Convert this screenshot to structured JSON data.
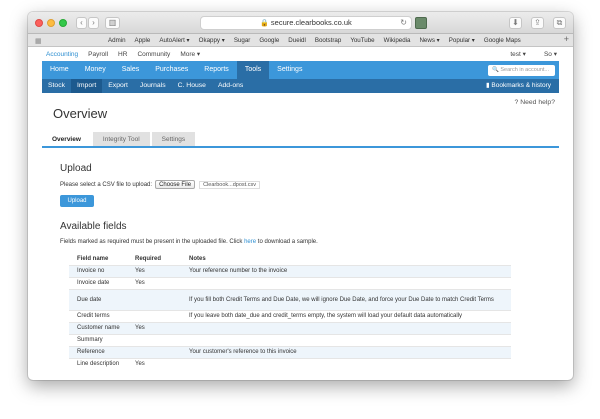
{
  "browser": {
    "url": "secure.clearbooks.co.uk",
    "bookmarks": [
      "Admin",
      "Apple",
      "AutoAlert ▾",
      "Okappy ▾",
      "Sugar",
      "Google",
      "Dueidl",
      "Bootstrap",
      "YouTube",
      "Wikipedia",
      "News ▾",
      "Popular ▾",
      "Google Maps"
    ]
  },
  "appnav": {
    "items": [
      "Accounting",
      "Payroll",
      "HR",
      "Community",
      "More ▾"
    ],
    "user": "test ▾",
    "user2": "So ▾"
  },
  "mainnav": {
    "items": [
      "Home",
      "Money",
      "Sales",
      "Purchases",
      "Reports",
      "Tools",
      "Settings"
    ],
    "search_placeholder": "Search in account..."
  },
  "subnav": {
    "items": [
      "Stock",
      "Import",
      "Export",
      "Journals",
      "C. House",
      "Add-ons"
    ],
    "bookmarks_history": "Bookmarks & history"
  },
  "page": {
    "title": "Overview",
    "help": "Need help?",
    "tabs": [
      "Overview",
      "Integrity Tool",
      "Settings"
    ]
  },
  "upload": {
    "heading": "Upload",
    "label": "Please select a CSV file to upload:",
    "choose_file": "Choose File",
    "file_name": "Clearbook...dpost.csv",
    "button": "Upload"
  },
  "fields": {
    "heading": "Available fields",
    "intro_prefix": "Fields marked as required must be present in the uploaded file. Click ",
    "intro_link": "here",
    "intro_suffix": " to download a sample.",
    "columns": [
      "Field name",
      "Required",
      "Notes"
    ],
    "rows": [
      {
        "name": "Invoice no",
        "required": "Yes",
        "notes": "Your reference number to the invoice"
      },
      {
        "name": "Invoice date",
        "required": "Yes",
        "notes": ""
      },
      {
        "name": "Due date",
        "required": "",
        "notes": "If you fill both Credit Terms and Due Date, we will ignore Due Date, and force your Due Date to match Credit Terms"
      },
      {
        "name": "Credit terms",
        "required": "",
        "notes": "If you leave both date_due and credit_terms empty, the system will load your default data automatically"
      },
      {
        "name": "Customer name",
        "required": "Yes",
        "notes": ""
      },
      {
        "name": "Summary",
        "required": "",
        "notes": ""
      },
      {
        "name": "Reference",
        "required": "",
        "notes": "Your customer's reference to this invoice"
      },
      {
        "name": "Line description",
        "required": "Yes",
        "notes": ""
      }
    ]
  }
}
